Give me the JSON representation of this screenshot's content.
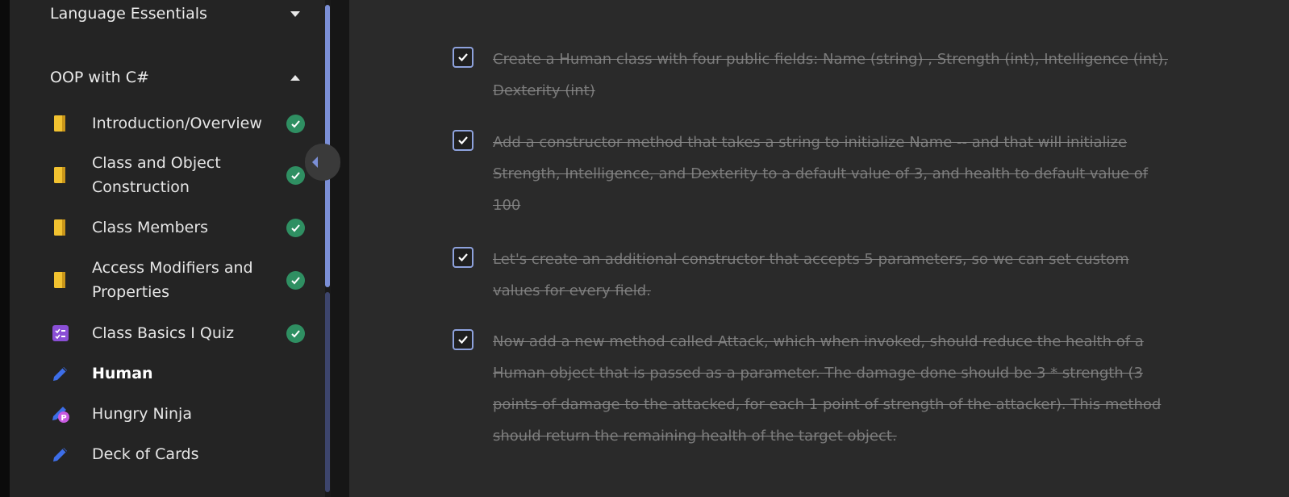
{
  "sidebar": {
    "sections": [
      {
        "title": "Language Essentials",
        "expanded": false
      },
      {
        "title": "OOP with C#",
        "expanded": true
      }
    ],
    "items": [
      {
        "label": "Introduction/Overview",
        "icon": "book-icon",
        "completed": true
      },
      {
        "label": "Class and Object Construction",
        "icon": "book-icon",
        "completed": true
      },
      {
        "label": "Class Members",
        "icon": "book-icon",
        "completed": true
      },
      {
        "label": "Access Modifiers and Properties",
        "icon": "book-icon",
        "completed": true
      },
      {
        "label": "Class Basics I Quiz",
        "icon": "quiz-icon",
        "completed": true
      },
      {
        "label": "Human",
        "icon": "pencil-icon",
        "active": true
      },
      {
        "label": "Hungry Ninja",
        "icon": "pencil-premium-icon"
      },
      {
        "label": "Deck of Cards",
        "icon": "pencil-icon"
      }
    ]
  },
  "tasks": [
    {
      "text": "Create a Human class with four public fields: Name (string) , Strength (int), Intelligence (int), Dexterity (int)",
      "checked": true
    },
    {
      "text": "Add a constructor method that takes a string to initialize Name -- and that will initialize Strength, Intelligence, and Dexterity to a default value of 3, and health to default value of 100",
      "checked": true
    },
    {
      "text": "Let's create an additional constructor that accepts 5 parameters, so we can set custom values for every field.",
      "checked": true
    },
    {
      "text": "Now add a new method called Attack, which when invoked, should reduce the health of a Human object that is passed as a parameter. The damage done should be 3 * strength (3 points of damage to the attacked, for each 1 point of strength of the attacker). This method should return the remaining health of the target object.",
      "checked": true
    }
  ],
  "colors": {
    "accent": "#7b8fd6",
    "completed": "#2f8f62",
    "book": "#f2c230",
    "quiz": "#8a4fd6",
    "pencil": "#3d6ee8"
  }
}
